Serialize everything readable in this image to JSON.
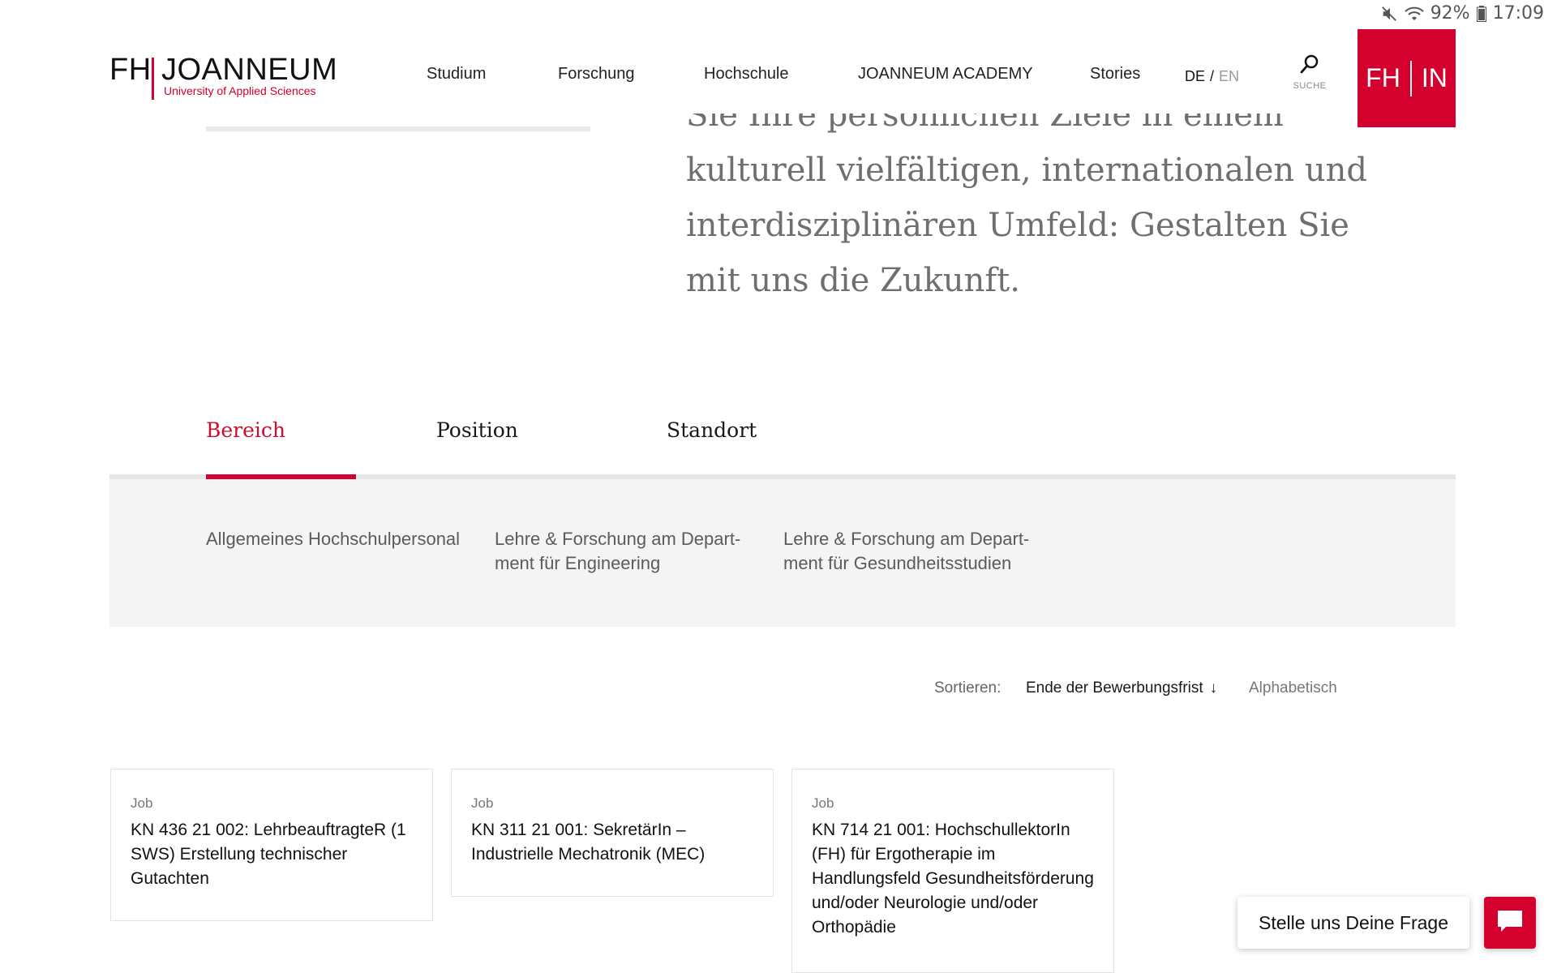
{
  "status": {
    "battery": "92%",
    "time": "17:09",
    "icons": [
      "mute-icon",
      "wifi-icon",
      "battery-icon"
    ]
  },
  "header": {
    "logo": {
      "fh": "FH",
      "name": "JOANNEUM",
      "subtitle": "University of Applied Sciences"
    },
    "nav": [
      "Studium",
      "Forschung",
      "Hochschule",
      "JOANNEUM ACADEMY",
      "Stories"
    ],
    "lang": {
      "active": "DE",
      "separator": "/",
      "other": "EN"
    },
    "search_label": "SUCHE",
    "fhin": {
      "left": "FH",
      "right": "IN"
    }
  },
  "hero": {
    "lines": [
      "Sie Ihre persönlichen Ziele in einem",
      "kulturell vielfältigen, internationalen und",
      "interdisziplinären Umfeld: Gestalten Sie",
      "mit uns die Zukunft."
    ]
  },
  "tabs": [
    "Bereich",
    "Position",
    "Standort"
  ],
  "filters": [
    "Allgemeines Hochschulpersonal",
    "Lehre & Forschung am Depart-\nment für Engineering",
    "Lehre & Forschung am Depart-\nment für Gesundheitsstudien"
  ],
  "sort": {
    "label": "Sortieren:",
    "active": "Ende der Bewerbungsfrist",
    "active_arrow": "↓",
    "alternative": "Alphabetisch"
  },
  "cards": [
    {
      "type": "Job",
      "title": "KN 436 21 002: LehrbeauftragteR (1 SWS) Erstellung technischer Gutachten"
    },
    {
      "type": "Job",
      "title": "KN 311 21 001: SekretärIn – Industrielle Mechatronik (MEC)"
    },
    {
      "type": "Job",
      "title": "KN 714 21 001: HochschullektorIn (FH) für Ergotherapie im Handlungsfeld Gesundheitsförderung und/oder Neurologie und/oder Orthopädie"
    }
  ],
  "chat": {
    "label": "Stelle uns Deine Frage",
    "icon": "chat-icon"
  },
  "colors": {
    "brand_red": "#d4002d",
    "panel_grey": "#f4f4f4",
    "hero_text": "#6f6f6f"
  }
}
